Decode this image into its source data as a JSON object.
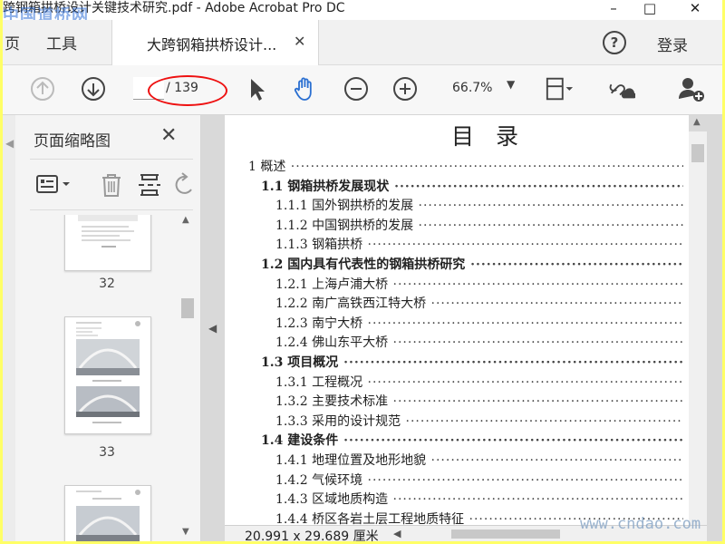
{
  "window": {
    "title": "跨钢箱拱桥设计关键技术研究.pdf - Adobe Acrobat Pro DC",
    "watermark_top": "中国道桥网",
    "minimize": "–",
    "maximize": "□",
    "close": "✕"
  },
  "menubar": {
    "home": "页",
    "tools": "工具",
    "doc_tab": "大跨钢箱拱桥设计...",
    "doc_tab_close": "✕",
    "help": "?",
    "login": "登录"
  },
  "toolbar": {
    "page_current": "",
    "page_total": "/ 139",
    "zoom": "66.7%",
    "zoom_arrow": "▼"
  },
  "sidebar": {
    "title": "页面缩略图",
    "close": "✕",
    "thumbnails": [
      {
        "label": "32"
      },
      {
        "label": "33"
      }
    ]
  },
  "document": {
    "toc_title": "目录",
    "toc": [
      {
        "text": "1 概述",
        "level": 0
      },
      {
        "text": "1.1 钢箱拱桥发展现状",
        "level": 1
      },
      {
        "text": "1.1.1 国外钢拱桥的发展",
        "level": 2
      },
      {
        "text": "1.1.2 中国钢拱桥的发展",
        "level": 2
      },
      {
        "text": "1.1.3 钢箱拱桥",
        "level": 2
      },
      {
        "text": "1.2 国内具有代表性的钢箱拱桥研究",
        "level": 1
      },
      {
        "text": "1.2.1 上海卢浦大桥",
        "level": 2
      },
      {
        "text": "1.2.2 南广高铁西江特大桥",
        "level": 2
      },
      {
        "text": "1.2.3 南宁大桥",
        "level": 2
      },
      {
        "text": "1.2.4 佛山东平大桥",
        "level": 2
      },
      {
        "text": "1.3 项目概况",
        "level": 1
      },
      {
        "text": "1.3.1 工程概况",
        "level": 2
      },
      {
        "text": "1.3.2 主要技术标准",
        "level": 2
      },
      {
        "text": "1.3.3 采用的设计规范",
        "level": 2
      },
      {
        "text": "1.4 建设条件",
        "level": 1
      },
      {
        "text": "1.4.1 地理位置及地形地貌",
        "level": 2
      },
      {
        "text": "1.4.2 气候环境",
        "level": 2
      },
      {
        "text": "1.4.3 区域地质构造",
        "level": 2
      },
      {
        "text": "1.4.4 桥区各岩土层工程地质特征",
        "level": 2
      }
    ]
  },
  "statusbar": {
    "page_size": "20.991 x 29.689 厘米"
  },
  "watermark_bottom": "www.cndao.com",
  "colors": {
    "accent_blue": "#2a6fd1",
    "annotation_red": "#e11111",
    "frame_yellow": "#ffff66"
  }
}
